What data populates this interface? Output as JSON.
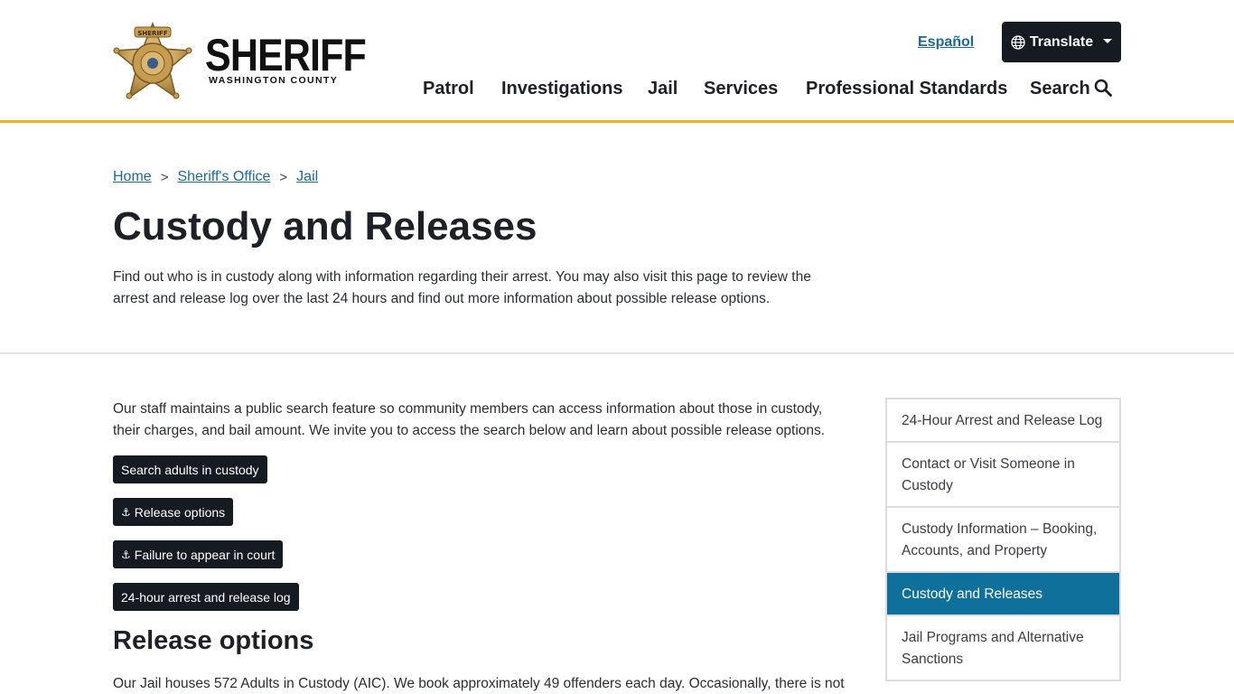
{
  "header": {
    "brand_title": "SHERIFF",
    "brand_subtitle": "WASHINGTON COUNTY",
    "badge_text": "SHERIFF",
    "language_link": "Español",
    "translate_label": "Translate",
    "nav": [
      "Patrol",
      "Investigations",
      "Jail",
      "Services",
      "Professional Standards",
      "Search"
    ]
  },
  "breadcrumb": [
    "Home",
    "Sheriff's Office",
    "Jail"
  ],
  "breadcrumb_separator": ">",
  "page": {
    "title": "Custody and Releases",
    "intro": "Find out who is in custody along with information regarding their arrest. You may also visit this page to review the arrest and release log over the last 24 hours and find out more information about possible release options.",
    "lead": "Our staff maintains a public search feature so community members can access information about those in custody, their charges, and bail amount. We invite you to access the search below and learn about possible release options.",
    "buttons": [
      {
        "label": "Search adults in custody",
        "icon": ""
      },
      {
        "label": "Release options",
        "icon": "⚓"
      },
      {
        "label": "Failure to appear in court",
        "icon": "⚓"
      },
      {
        "label": "24-hour arrest and release log",
        "icon": ""
      }
    ],
    "section_heading": "Release options",
    "section_text": "Our Jail houses 572 Adults in Custody (AIC). We book approximately 49 offenders each day. Occasionally, there is not"
  },
  "sidebar": {
    "items": [
      {
        "label": "24-Hour Arrest and Release Log",
        "active": false
      },
      {
        "label": "Contact or Visit Someone in Custody",
        "active": false
      },
      {
        "label": "Custody Information – Booking, Accounts, and Property",
        "active": false
      },
      {
        "label": "Custody and Releases",
        "active": true
      },
      {
        "label": "Jail Programs and Alternative Sanctions",
        "active": false
      }
    ]
  },
  "colors": {
    "accent_gold": "#f0b323",
    "link_blue": "#1a6b99",
    "button_dark": "#161b22",
    "active_blue": "#10709c"
  }
}
